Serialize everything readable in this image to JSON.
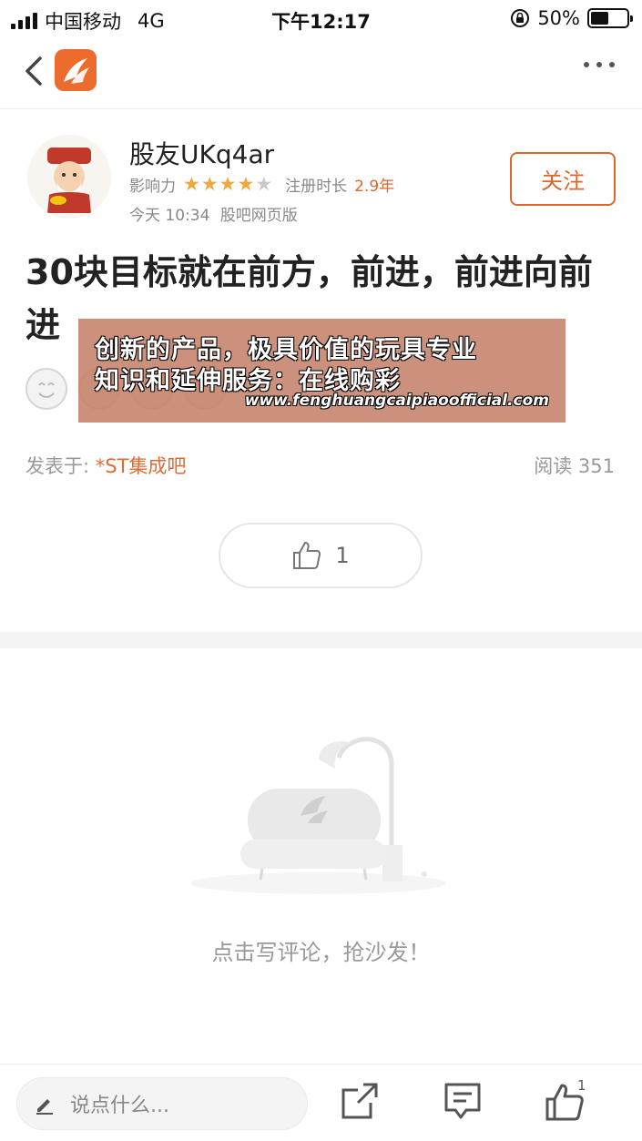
{
  "status_bar": {
    "carrier": "中国移动",
    "network": "4G",
    "time": "下午12:17",
    "battery_percent_text": "50%",
    "battery_level": 0.5,
    "icons": [
      "signal-icon",
      "orientation-lock-icon",
      "battery-icon"
    ]
  },
  "nav": {
    "back_icon": "chevron-left-icon",
    "logo_icon": "app-logo-icon",
    "more_icon": "more-dots-icon"
  },
  "author": {
    "name": "股友UKq4ar",
    "influence_label": "影响力",
    "influence_stars": 4,
    "influence_max": 5,
    "reg_label": "注册时长",
    "reg_value": "2.9年",
    "post_time": "今天 10:34",
    "post_source": "股吧网页版",
    "follow_label": "关注"
  },
  "post": {
    "title": "30块目标就在前方，前进，前进向前进",
    "posted_in_label": "发表于: ",
    "forum_name": "*ST集成吧",
    "read_label": "阅读 351",
    "like_count": "1"
  },
  "ad": {
    "line1": "创新的产品，极具价值的玩具专业",
    "line2": "知识和延伸服务：在线购彩",
    "url": "www.fenghuangcaipiaoofficial.com"
  },
  "empty_comments": {
    "text": "点击写评论，抢沙发！"
  },
  "bottom_bar": {
    "input_placeholder": "说点什么...",
    "like_badge": "1",
    "icons": [
      "edit-icon",
      "share-icon",
      "comment-icon",
      "like-icon"
    ]
  },
  "colors": {
    "accent": "#e0662b",
    "star_on": "#f0a73c",
    "star_off": "#c9c9c9",
    "ad_bg": "#c4826a"
  }
}
